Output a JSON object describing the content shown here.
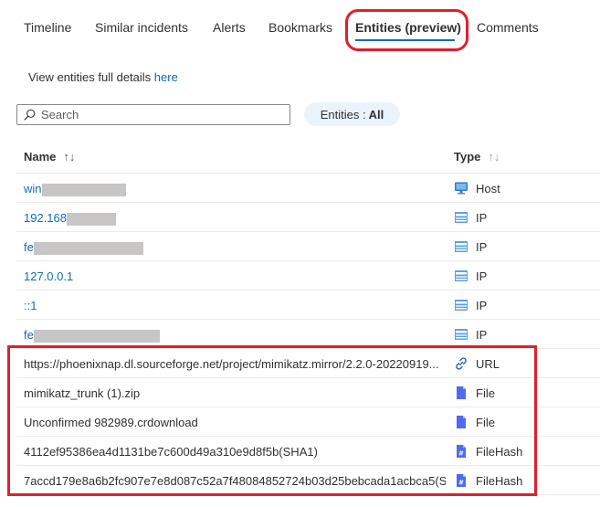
{
  "tabs": [
    {
      "label": "Timeline"
    },
    {
      "label": "Similar incidents"
    },
    {
      "label": "Alerts"
    },
    {
      "label": "Bookmarks"
    },
    {
      "label": "Entities (preview)"
    },
    {
      "label": "Comments"
    }
  ],
  "active_tab": "Entities (preview)",
  "view_entities": {
    "text": "View entities full details ",
    "link": "here"
  },
  "search": {
    "placeholder": "Search"
  },
  "filter": {
    "label": "Entities : ",
    "value": "All"
  },
  "columns": {
    "name": "Name",
    "type": "Type",
    "sort_icon": "↑↓"
  },
  "rows": [
    {
      "name": "win",
      "redacted": true,
      "link": true,
      "type": "Host",
      "icon": "host-icon"
    },
    {
      "name": "192.168",
      "redacted": true,
      "link": true,
      "type": "IP",
      "icon": "ip-icon"
    },
    {
      "name": "fe",
      "redacted": true,
      "link": true,
      "type": "IP",
      "icon": "ip-icon"
    },
    {
      "name": "127.0.0.1",
      "redacted": false,
      "link": true,
      "type": "IP",
      "icon": "ip-icon"
    },
    {
      "name": "::1",
      "redacted": false,
      "link": true,
      "type": "IP",
      "icon": "ip-icon"
    },
    {
      "name": "fe",
      "redacted": true,
      "link": true,
      "type": "IP",
      "icon": "ip-icon"
    },
    {
      "name": "https://phoenixnap.dl.sourceforge.net/project/mimikatz.mirror/2.2.0-20220919...",
      "redacted": false,
      "link": false,
      "type": "URL",
      "icon": "link-icon"
    },
    {
      "name": "mimikatz_trunk (1).zip",
      "redacted": false,
      "link": false,
      "type": "File",
      "icon": "file-icon"
    },
    {
      "name": "Unconfirmed 982989.crdownload",
      "redacted": false,
      "link": false,
      "type": "File",
      "icon": "file-icon"
    },
    {
      "name": "4112ef95386ea4d1131be7c600d49a310e9d8f5b(SHA1)",
      "redacted": false,
      "link": false,
      "type": "FileHash",
      "icon": "filehash-icon"
    },
    {
      "name": "7accd179e8a6b2fc907e7e8d087c52a7f48084852724b03d25bebcada1acbca5(S...",
      "redacted": false,
      "link": false,
      "type": "FileHash",
      "icon": "filehash-icon"
    }
  ],
  "colors": {
    "accent": "#0f6cbd",
    "highlight": "#e01e2e",
    "pill_bg": "#ebf3fc"
  }
}
